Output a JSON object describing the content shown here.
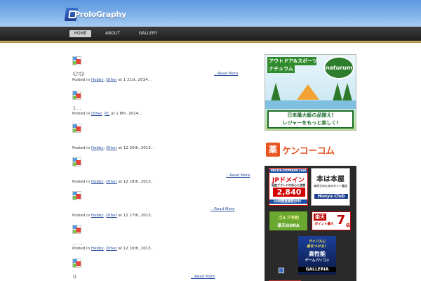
{
  "site": {
    "logo_text": "ProloGraphy"
  },
  "nav": {
    "items": [
      "HOME",
      "ABOUT",
      "GALLERY"
    ]
  },
  "posts": [
    {
      "excerpt": "(ﾟ▽ﾟ)",
      "read_more": "...Read More",
      "posted_in": "Posted in",
      "categories": [
        "Hobby",
        "Other"
      ],
      "at_prefix": "at",
      "date": "1 21st, 2014.",
      "suffix": "."
    },
    {
      "excerpt": "1 ...",
      "read_more": "",
      "posted_in": "Posted in",
      "categories": [
        "Other",
        "PC"
      ],
      "at_prefix": "at",
      "date": "1 6th, 2014.",
      "suffix": "."
    },
    {
      "excerpt": "",
      "read_more": "",
      "posted_in": "Posted in",
      "categories": [
        "Hobby",
        "Other"
      ],
      "at_prefix": "at",
      "date": "12 20th, 2013.",
      "suffix": "."
    },
    {
      "excerpt": "",
      "read_more": "...Read More",
      "posted_in": "Posted in",
      "categories": [
        "Hobby",
        "Other"
      ],
      "at_prefix": "at",
      "date": "12 18th, 2013.",
      "suffix": "."
    },
    {
      "excerpt": "",
      "read_more": "...Read More",
      "posted_in": "Posted in",
      "categories": [
        "Hobby",
        "Other"
      ],
      "at_prefix": "at",
      "date": "12 17th, 2013.",
      "suffix": "."
    },
    {
      "excerpt": "... ...",
      "read_more": "",
      "posted_in": "Posted in",
      "categories": [
        "Hobby",
        "Other"
      ],
      "at_prefix": "at",
      "date": "12 16th, 2013.",
      "suffix": "."
    },
    {
      "excerpt": "()",
      "read_more": "...Read More"
    }
  ],
  "sidebar": {
    "outdoor_ad": {
      "headline_1": "アウトドア&スポーツ",
      "headline_2": "ナチュラム",
      "brand": "naturum",
      "tagline_1": "日本最大級の品揃え!",
      "tagline_2": "レジャーをもっと楽しく!"
    },
    "kenko_ad": {
      "icon_text": "薬",
      "text": "ケンコーコム"
    },
    "panel_ads": {
      "value_domain": "VALUE-DOMAIN.com",
      "jp_domain": "JPドメイン",
      "jp_sub": "国産ブランドの安心と信頼",
      "price": "2,840",
      "price_unit": "円",
      "hours": "24時間登録受付中！",
      "honya_title": "本は本屋",
      "honya_sub": "本好きのためのネット書店",
      "honya_club": "Honya Club",
      "golf_line1": "ゴルフ予約",
      "golf_line2": "楽天GORA",
      "rakuten_title": "楽天",
      "rakuten_points": "ポイント最大",
      "rakuten_num": "7",
      "rakuten_unit": "倍",
      "galleria_line1": "ライバルに",
      "galleria_line2": "差をつける！",
      "galleria_line3": "高性能",
      "galleria_line4": "ゲームパソコン",
      "galleria_brand": "GALLERIA"
    }
  }
}
